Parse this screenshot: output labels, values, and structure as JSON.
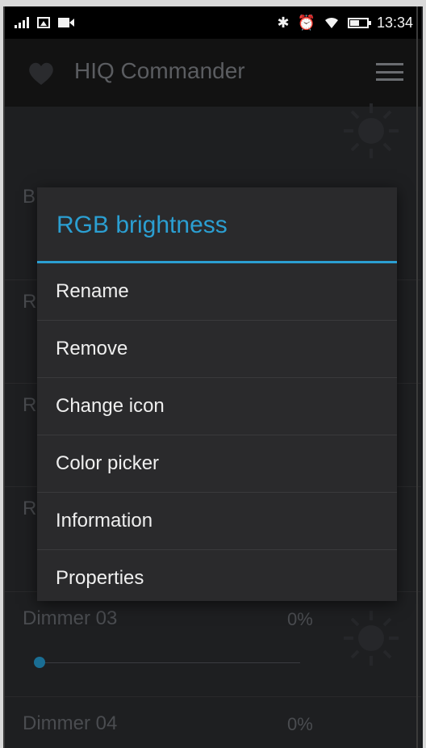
{
  "status_bar": {
    "time": "13:34",
    "icons": [
      "signal-icon",
      "image-icon",
      "video-icon",
      "bluetooth-icon",
      "alarm-icon",
      "wifi-icon",
      "battery-icon"
    ]
  },
  "app_bar": {
    "title": "HIQ Commander",
    "icons": [
      "heart-logo-icon",
      "menu-icon"
    ]
  },
  "background_list": {
    "partial_labels": [
      "B",
      "R",
      "R",
      "R"
    ],
    "items": [
      {
        "label": "Dimmer 03",
        "value": "0%"
      },
      {
        "label": "Dimmer 04",
        "value": "0%"
      }
    ]
  },
  "dialog": {
    "title": "RGB brightness",
    "items": [
      "Rename",
      "Remove",
      "Change icon",
      "Color picker",
      "Information",
      "Properties"
    ]
  },
  "colors": {
    "accent": "#2b9fd2",
    "dialog_bg": "#2a2a2c",
    "background": "#1e1f21",
    "status_bar": "#000000"
  }
}
